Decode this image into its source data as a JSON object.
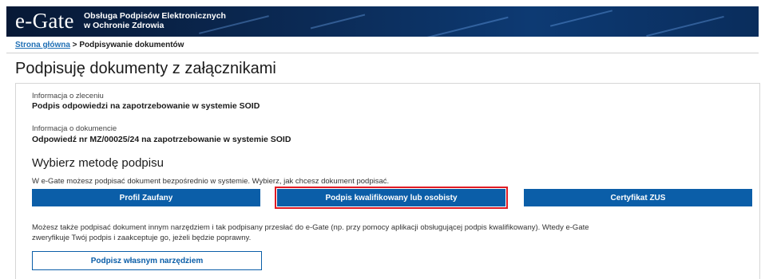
{
  "header": {
    "logo": "e-Gate",
    "subtitle_line1": "Obsługa Podpisów Elektronicznych",
    "subtitle_line2": "w Ochronie Zdrowia",
    "colors": {
      "banner": "#0b2a55",
      "accent": "#0b5ea8",
      "highlight": "#e01b24"
    }
  },
  "breadcrumb": {
    "home": "Strona główna",
    "separator": " > ",
    "current": "Podpisywanie dokumentów"
  },
  "page": {
    "title": "Podpisuję dokumenty z załącznikami"
  },
  "order": {
    "label": "Informacja o zleceniu",
    "value": "Podpis odpowiedzi na zapotrzebowanie w systemie SOID"
  },
  "document": {
    "label": "Informacja o dokumencie",
    "value": "Odpowiedź nr MZ/00025/24 na zapotrzebowanie w systemie SOID"
  },
  "method": {
    "title": "Wybierz metodę podpisu",
    "intro": "W e-Gate możesz podpisać dokument bezpośrednio w systemie. Wybierz, jak chcesz dokument podpisać.",
    "buttons": {
      "profil": "Profil Zaufany",
      "kwalifikowany": "Podpis kwalifikowany lub osobisty",
      "zus": "Certyfikat ZUS"
    },
    "alt_line1": "Możesz także podpisać dokument innym narzędziem i tak podpisany przesłać do e-Gate (np. przy pomocy aplikacji obsługującej podpis kwalifikowany). Wtedy e-Gate",
    "alt_line2": "zweryfikuje Twój podpis i zaakceptuje go, jeżeli będzie poprawny.",
    "own_tool": "Podpisz własnym narzędziem"
  }
}
